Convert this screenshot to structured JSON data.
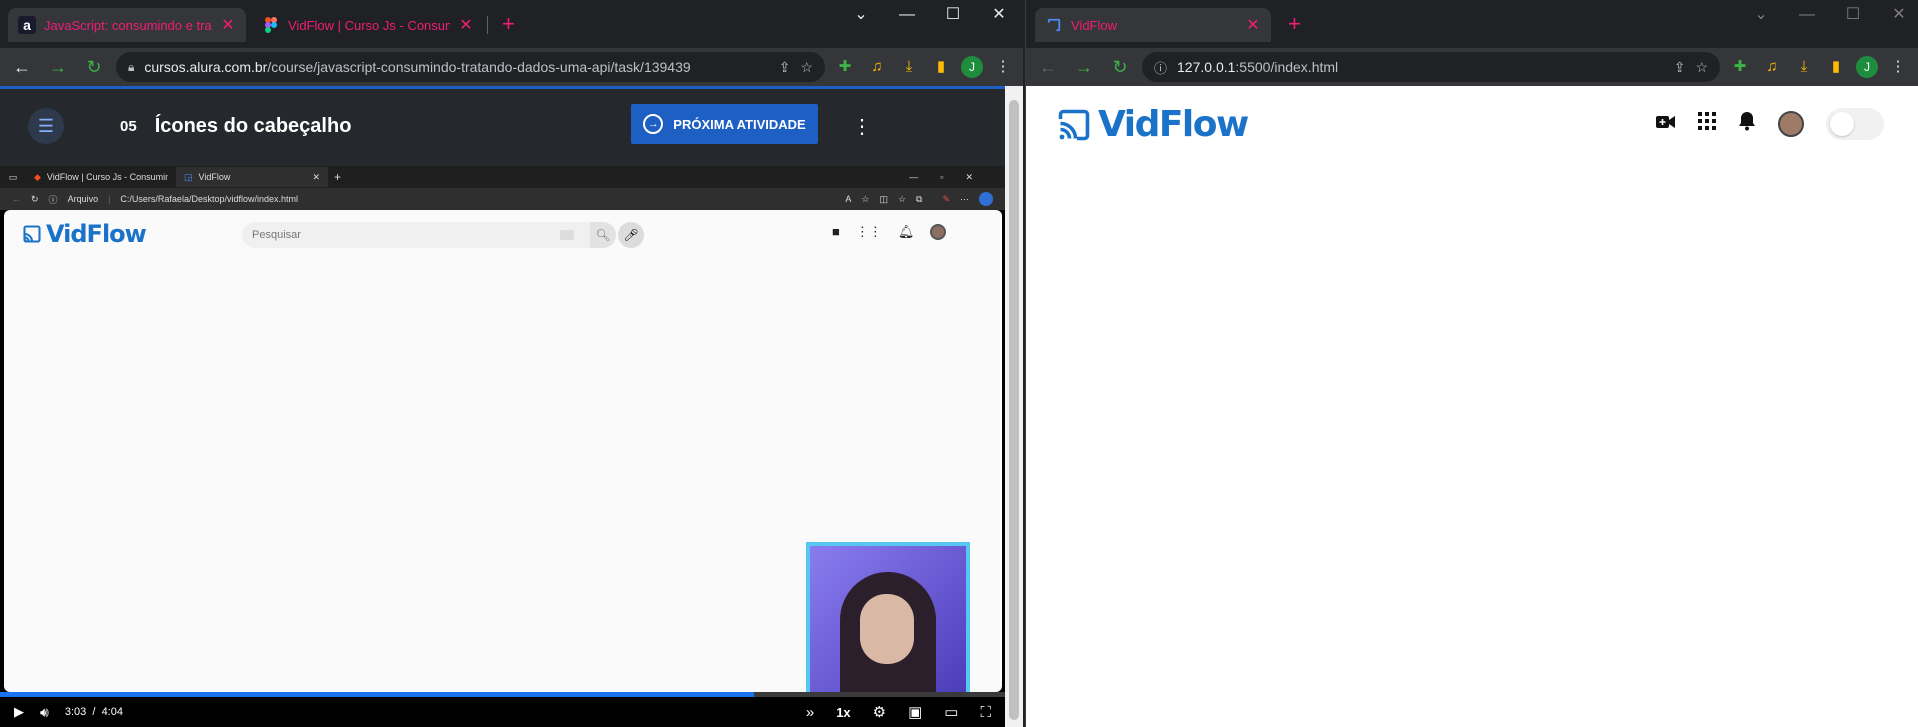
{
  "left_window": {
    "tabs": [
      {
        "title": "JavaScript: consumindo e tratan",
        "favicon": "a",
        "active": true
      },
      {
        "title": "VidFlow | Curso Js - Consumindo",
        "favicon": "figma-icon",
        "active": false
      }
    ],
    "url_host": "cursos.alura.com.br",
    "url_path": "/course/javascript-consumindo-tratando-dados-uma-api/task/139439",
    "profile_initial": "J",
    "course": {
      "lesson_number": "05",
      "lesson_title": "Ícones do cabeçalho",
      "next_button": "PRÓXIMA ATIVIDADE"
    },
    "video": {
      "inner_tabs": [
        "VidFlow | Curso Js - Consumindo",
        "VidFlow"
      ],
      "inner_address_label": "Arquivo",
      "inner_address": "C:/Users/Rafaela/Desktop/vidflow/index.html",
      "inner_logo": "VidFlow",
      "inner_search_placeholder": "Pesquisar",
      "current_time": "3:03",
      "separator": "/",
      "duration": "4:04",
      "progress": 0.75,
      "speed": "1x"
    }
  },
  "right_window": {
    "tab_title": "VidFlow",
    "url_host": "127.0.0.1",
    "url_path": ":5500/index.html",
    "profile_initial": "J",
    "logo": "VidFlow",
    "accent_color": "#1a73c9"
  }
}
